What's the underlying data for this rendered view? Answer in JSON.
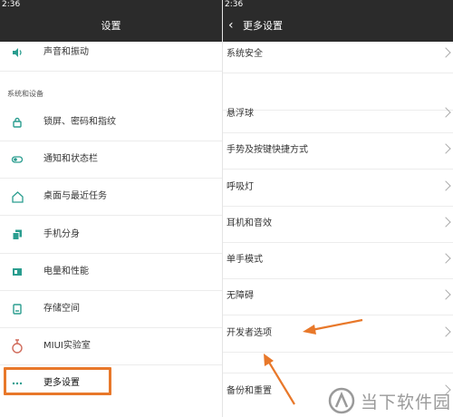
{
  "left_screen": {
    "status_time": "2:36",
    "title": "设置",
    "top_item": {
      "label": "声音和振动",
      "icon": "speaker-icon"
    },
    "section_header": "系统和设备",
    "items": [
      {
        "label": "锁屏、密码和指纹",
        "icon": "lock-icon"
      },
      {
        "label": "通知和状态栏",
        "icon": "toggle-icon"
      },
      {
        "label": "桌面与最近任务",
        "icon": "home-icon"
      },
      {
        "label": "手机分身",
        "icon": "clone-icon"
      },
      {
        "label": "电量和性能",
        "icon": "battery-icon"
      },
      {
        "label": "存储空间",
        "icon": "storage-icon"
      },
      {
        "label": "MIUI实验室",
        "icon": "flask-icon"
      },
      {
        "label": "更多设置",
        "icon": "more-icon"
      }
    ]
  },
  "right_screen": {
    "status_time": "2:36",
    "back_icon": "back-arrow-icon",
    "title": "更多设置",
    "items": [
      {
        "label": "系统安全"
      },
      {
        "label": ""
      },
      {
        "label": "悬浮球"
      },
      {
        "label": "手势及按键快捷方式"
      },
      {
        "label": "呼吸灯"
      },
      {
        "label": "耳机和音效"
      },
      {
        "label": "单手模式"
      },
      {
        "label": "无障碍"
      },
      {
        "label": "开发者选项"
      },
      {
        "label": ""
      },
      {
        "label": "备份和重置"
      }
    ]
  },
  "watermark": {
    "text": "当下软件园",
    "icon": "watermark-logo-icon"
  },
  "colors": {
    "accent_teal": "#2a9d8f",
    "annotation_orange": "#e8782a",
    "titlebar": "#2b2b2b"
  }
}
